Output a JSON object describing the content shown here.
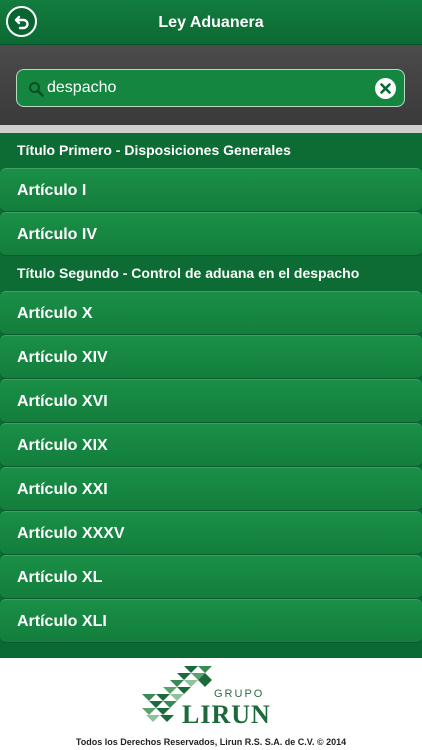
{
  "header": {
    "title": "Ley Aduanera"
  },
  "search": {
    "value": "despacho"
  },
  "sections": [
    {
      "title": "Título Primero - Disposiciones Generales",
      "items": [
        "Artículo I",
        "Artículo IV"
      ]
    },
    {
      "title": "Título Segundo - Control de aduana en el despacho",
      "items": [
        "Artículo X",
        "Artículo XIV",
        "Artículo XVI",
        "Artículo XIX",
        "Artículo XXI",
        "Artículo XXXV",
        "Artículo XL",
        "Artículo XLI"
      ]
    }
  ],
  "footer": {
    "logo_small": "GRUPO",
    "logo_brand": "LIRUN",
    "copyright": "Todos los Derechos Reservados, Lirun R.S. S.A. de C.V. © 2014"
  },
  "colors": {
    "brand_green": "#137c3f",
    "search_bg": "#4b4b4b"
  },
  "icons": {
    "back": "back-arrow-icon",
    "search": "search-icon",
    "clear": "close-icon"
  }
}
